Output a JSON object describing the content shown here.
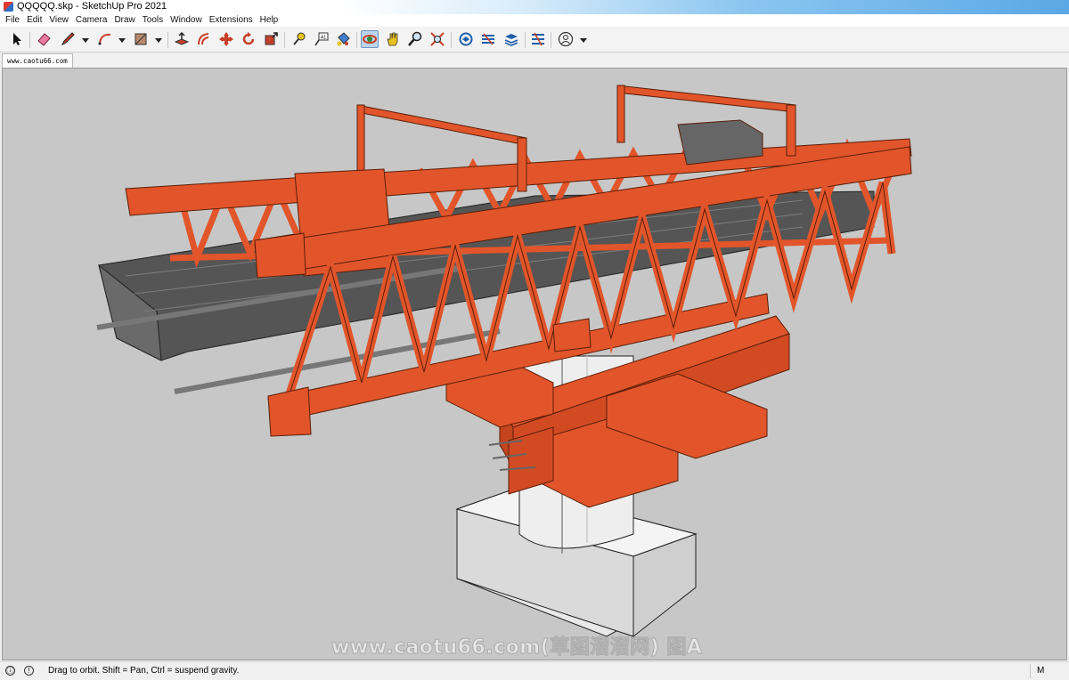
{
  "window": {
    "title": "QQQQQ.skp - SketchUp Pro 2021"
  },
  "menu": [
    "File",
    "Edit",
    "View",
    "Camera",
    "Draw",
    "Tools",
    "Window",
    "Extensions",
    "Help"
  ],
  "toolbar": {
    "tools": [
      {
        "name": "select-tool-button",
        "icon": "arrow-cursor-icon"
      },
      {
        "name": "eraser-tool-button",
        "icon": "eraser-icon"
      },
      {
        "name": "line-tool-button",
        "icon": "pencil-icon"
      },
      {
        "name": "arc-tool-button",
        "icon": "arc-icon"
      },
      {
        "name": "shape-tool-button",
        "icon": "rectangle-icon"
      },
      {
        "name": "push-pull-tool-button",
        "icon": "push-pull-icon"
      },
      {
        "name": "offset-tool-button",
        "icon": "offset-icon"
      },
      {
        "name": "move-tool-button",
        "icon": "move-arrows-icon"
      },
      {
        "name": "rotate-tool-button",
        "icon": "rotate-icon"
      },
      {
        "name": "scale-tool-button",
        "icon": "scale-icon"
      },
      {
        "name": "tape-measure-tool-button",
        "icon": "tape-measure-icon"
      },
      {
        "name": "text-tool-button",
        "icon": "text-label-icon"
      },
      {
        "name": "paint-bucket-tool-button",
        "icon": "paint-bucket-icon"
      },
      {
        "name": "orbit-tool-button",
        "icon": "orbit-icon",
        "active": true
      },
      {
        "name": "pan-tool-button",
        "icon": "hand-icon"
      },
      {
        "name": "zoom-tool-button",
        "icon": "magnifier-icon"
      },
      {
        "name": "zoom-extents-button",
        "icon": "zoom-extents-icon"
      },
      {
        "name": "3d-warehouse-button",
        "icon": "warehouse-icon"
      },
      {
        "name": "extension-warehouse-button",
        "icon": "extension-icon"
      },
      {
        "name": "layout-button",
        "icon": "layers-icon"
      },
      {
        "name": "extension-manager-button",
        "icon": "extension-manager-icon"
      },
      {
        "name": "account-button",
        "icon": "user-icon"
      }
    ]
  },
  "scene_tab": {
    "label": "www.caotu66.com"
  },
  "watermark": "www.caotu66.com(草图溜溜网) 图A",
  "status": {
    "message": "Drag to orbit. Shift = Pan, Ctrl = suspend gravity.",
    "measurements_label": "M"
  },
  "colors": {
    "truss_orange": "#e2552a",
    "truss_dark": "#7a2a12",
    "deck_gray": "#5a5a5a",
    "pier_white": "#ececec",
    "background": "#c7c7c7"
  }
}
